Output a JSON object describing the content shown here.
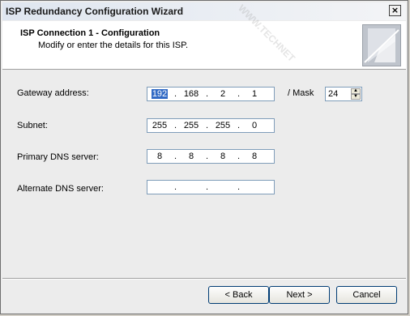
{
  "window": {
    "title": "ISP Redundancy Configuration Wizard",
    "close_glyph": "×"
  },
  "header": {
    "title": "ISP Connection 1 - Configuration",
    "subtitle": "Modify or enter the details for this ISP."
  },
  "form": {
    "gateway": {
      "label": "Gateway address:",
      "octets": [
        "192",
        "168",
        "2",
        "1"
      ]
    },
    "mask": {
      "label": "/ Mask",
      "value": "24"
    },
    "subnet": {
      "label": "Subnet:",
      "octets": [
        "255",
        "255",
        "255",
        "0"
      ]
    },
    "primary_dns": {
      "label": "Primary DNS server:",
      "octets": [
        "8",
        "8",
        "8",
        "8"
      ]
    },
    "alternate_dns": {
      "label": "Alternate DNS server:",
      "octets": [
        "",
        "",
        "",
        ""
      ]
    }
  },
  "buttons": {
    "back": "< Back",
    "next": "Next >",
    "cancel": "Cancel"
  },
  "watermark": "WWW.TECHNET"
}
